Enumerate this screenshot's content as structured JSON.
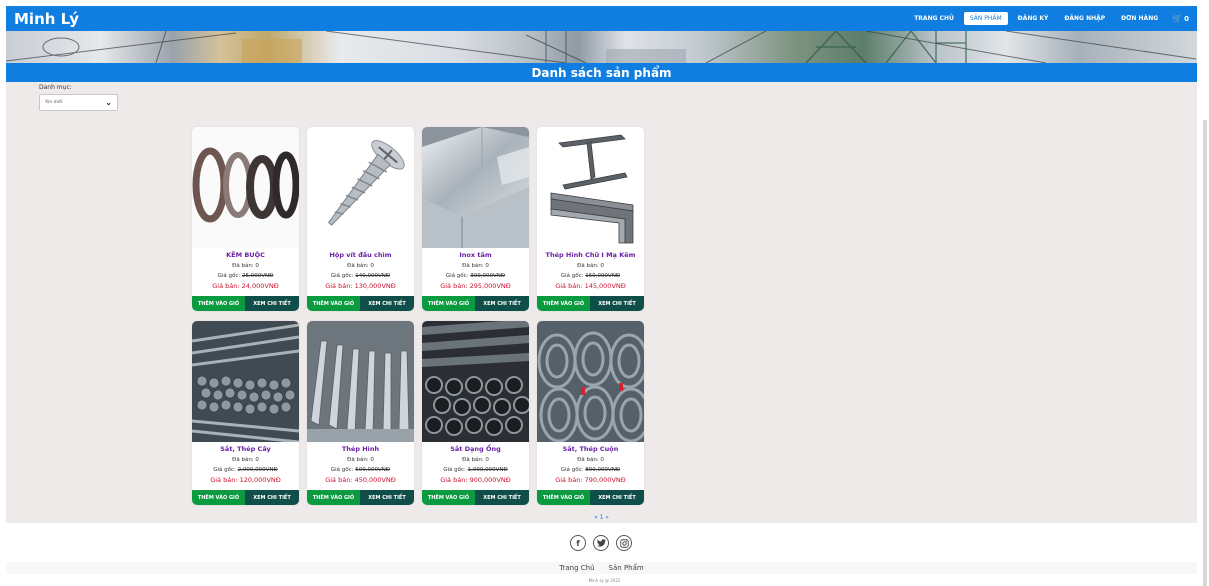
{
  "navbar": {
    "brand": "Minh Lý",
    "links": [
      "TRANG CHỦ",
      "SẢN PHẨM",
      "ĐĂNG KÝ",
      "ĐĂNG NHẬP",
      "ĐƠN HÀNG"
    ],
    "active_link": "SẢN PHẨM",
    "cart_count": "0"
  },
  "section": {
    "title": "Danh sách sản phẩm"
  },
  "filter": {
    "label": "Danh mục:",
    "selected": "Xin mời"
  },
  "products": [
    {
      "name": "KẼM BUỘC",
      "sold": "Đã bán: 0",
      "orig_label": "Giá gốc:",
      "orig_price": "25,000VNĐ",
      "sale": "Giá bán: 24,000VNĐ"
    },
    {
      "name": "Hộp vít đầu chìm",
      "sold": "Đã bán: 0",
      "orig_label": "Giá gốc:",
      "orig_price": "140,000VNĐ",
      "sale": "Giá bán: 130,000VNĐ"
    },
    {
      "name": "Inox tấm",
      "sold": "Đã bán: 0",
      "orig_label": "Giá gốc:",
      "orig_price": "300,000VNĐ",
      "sale": "Giá bán: 295,000VNĐ"
    },
    {
      "name": "Thép Hình Chữ I Mạ Kẽm",
      "sold": "Đã bán: 0",
      "orig_label": "Giá gốc:",
      "orig_price": "150,000VNĐ",
      "sale": "Giá bán: 145,000VNĐ"
    },
    {
      "name": "Sắt, Thép Cây",
      "sold": "Đã bán: 0",
      "orig_label": "Giá gốc:",
      "orig_price": "2,000,000VNĐ",
      "sale": "Giá bán: 120,000VNĐ"
    },
    {
      "name": "Thép Hình",
      "sold": "Đã bán: 0",
      "orig_label": "Giá gốc:",
      "orig_price": "500,000VNĐ",
      "sale": "Giá bán: 450,000VNĐ"
    },
    {
      "name": "Sắt Dạng Ống",
      "sold": "Đã bán: 0",
      "orig_label": "Giá gốc:",
      "orig_price": "1,000,000VNĐ",
      "sale": "Giá bán: 900,000VNĐ"
    },
    {
      "name": "Sắt, Thép Cuộn",
      "sold": "Đã bán: 0",
      "orig_label": "Giá gốc:",
      "orig_price": "800,000VNĐ",
      "sale": "Giá bán: 790,000VNĐ"
    }
  ],
  "buttons": {
    "add_to_cart": "THÊM VÀO GIỎ",
    "view_detail": "XEM CHI TIẾT"
  },
  "pagination": "« 1 »",
  "footer": {
    "links": [
      "Trang Chủ",
      "Sản Phẩm"
    ],
    "copyright": "Minh Lý @ 2022"
  },
  "colors": {
    "primary": "#0f7ee0",
    "add_button": "#0a9a3f",
    "detail_button": "#104e4a",
    "product_name": "#6a1fa8",
    "sale_price": "#c8102e"
  }
}
